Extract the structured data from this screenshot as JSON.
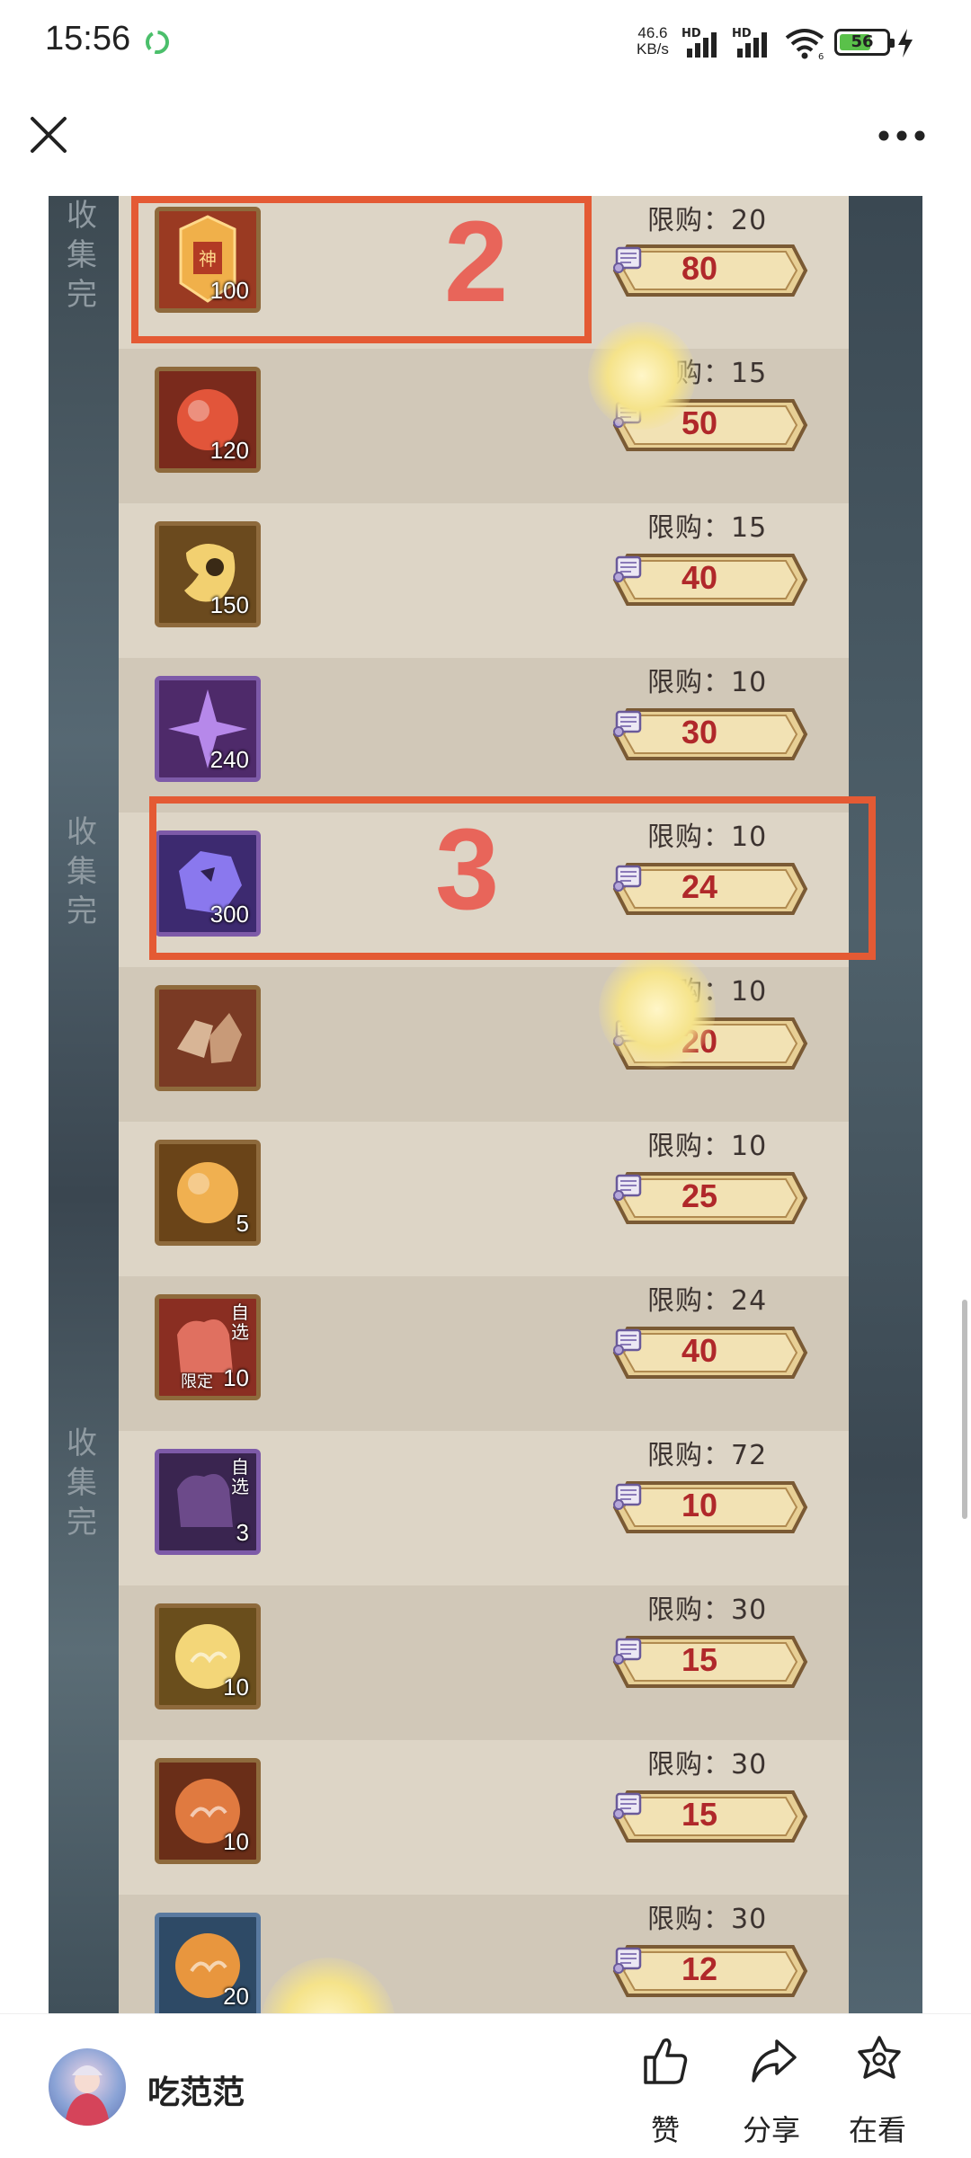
{
  "status": {
    "time": "15:56",
    "speed_top": "46.6",
    "speed_bottom": "KB/s",
    "hd": "HD",
    "battery": "56",
    "wifi_sub": "6"
  },
  "side_labels": [
    "收",
    "集",
    "完"
  ],
  "shop": {
    "limit_prefix": "限购：",
    "items": [
      {
        "icon": "divine-seal-icon",
        "count": "100",
        "limit": "20",
        "price": "80"
      },
      {
        "icon": "red-orb-icon",
        "count": "120",
        "limit": "15",
        "price": "50"
      },
      {
        "icon": "gold-crescent-icon",
        "count": "150",
        "limit": "15",
        "price": "40"
      },
      {
        "icon": "purple-star-icon",
        "count": "240",
        "limit": "10",
        "price": "30"
      },
      {
        "icon": "purple-crystal-icon",
        "count": "300",
        "limit": "10",
        "price": "24"
      },
      {
        "icon": "ore-chunks-icon",
        "count": "",
        "limit": "10",
        "price": "20"
      },
      {
        "icon": "gold-orb-icon",
        "count": "5",
        "limit": "10",
        "price": "25"
      },
      {
        "icon": "red-puzzle-icon",
        "count": "10",
        "limit": "24",
        "price": "40",
        "tag": "自选",
        "sub_tag": "限定"
      },
      {
        "icon": "purple-puzzle-icon",
        "count": "3",
        "limit": "72",
        "price": "10",
        "tag": "自选"
      },
      {
        "icon": "gold-cloud-coin-icon",
        "count": "10",
        "limit": "30",
        "price": "15"
      },
      {
        "icon": "red-coin-icon",
        "count": "10",
        "limit": "30",
        "price": "15"
      },
      {
        "icon": "dragon-coin-icon",
        "count": "20",
        "limit": "30",
        "price": "12"
      }
    ]
  },
  "annotations": [
    "2",
    "3"
  ],
  "footer": {
    "author": "吃范范",
    "like": "赞",
    "share": "分享",
    "watching": "在看"
  },
  "colors": {
    "annotation": "#e45a34",
    "price": "#b0282a",
    "panel": "#d8d0c1"
  }
}
